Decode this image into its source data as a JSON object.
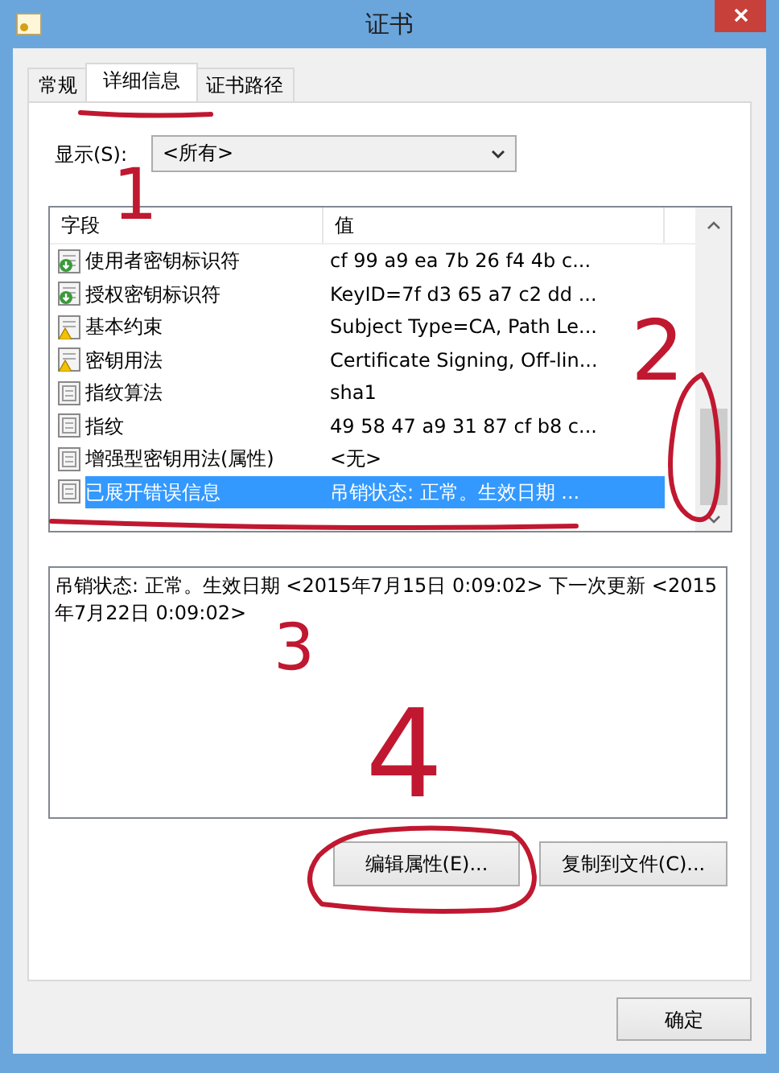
{
  "window": {
    "title": "证书"
  },
  "tabs": [
    {
      "label": "常规",
      "selected": false
    },
    {
      "label": "详细信息",
      "selected": true
    },
    {
      "label": "证书路径",
      "selected": false
    }
  ],
  "show": {
    "label": "显示(S):",
    "value": "<所有>"
  },
  "fields": {
    "columns": [
      "字段",
      "值"
    ],
    "rows": [
      {
        "kind": "key",
        "name": "使用者密钥标识符",
        "value": "cf 99 a9 ea 7b 26 f4 4b c...",
        "selected": false
      },
      {
        "kind": "key",
        "name": "授权密钥标识符",
        "value": "KeyID=7f d3 65 a7 c2 dd ...",
        "selected": false
      },
      {
        "kind": "warning",
        "name": "基本约束",
        "value": "Subject Type=CA, Path Le...",
        "selected": false
      },
      {
        "kind": "warning",
        "name": "密钥用法",
        "value": "Certificate Signing, Off-lin...",
        "selected": false
      },
      {
        "kind": "plain",
        "name": "指纹算法",
        "value": "sha1",
        "selected": false
      },
      {
        "kind": "plain",
        "name": "指纹",
        "value": "49 58 47 a9 31 87 cf b8 c...",
        "selected": false
      },
      {
        "kind": "plain",
        "name": "增强型密钥用法(属性)",
        "value": "<无>",
        "selected": false
      },
      {
        "kind": "plain",
        "name": "已展开错误信息",
        "value": "吊销状态: 正常。生效日期 ...",
        "selected": true
      }
    ]
  },
  "detail": "吊销状态: 正常。生效日期 <2015年7月15日 0:09:02> 下一次更新 <2015年7月22日 0:09:02>",
  "buttons": [
    "编辑属性(E)...",
    "复制到文件(C)..."
  ],
  "ok": "确定",
  "annotations": [
    "1",
    "2",
    "3",
    "4"
  ]
}
